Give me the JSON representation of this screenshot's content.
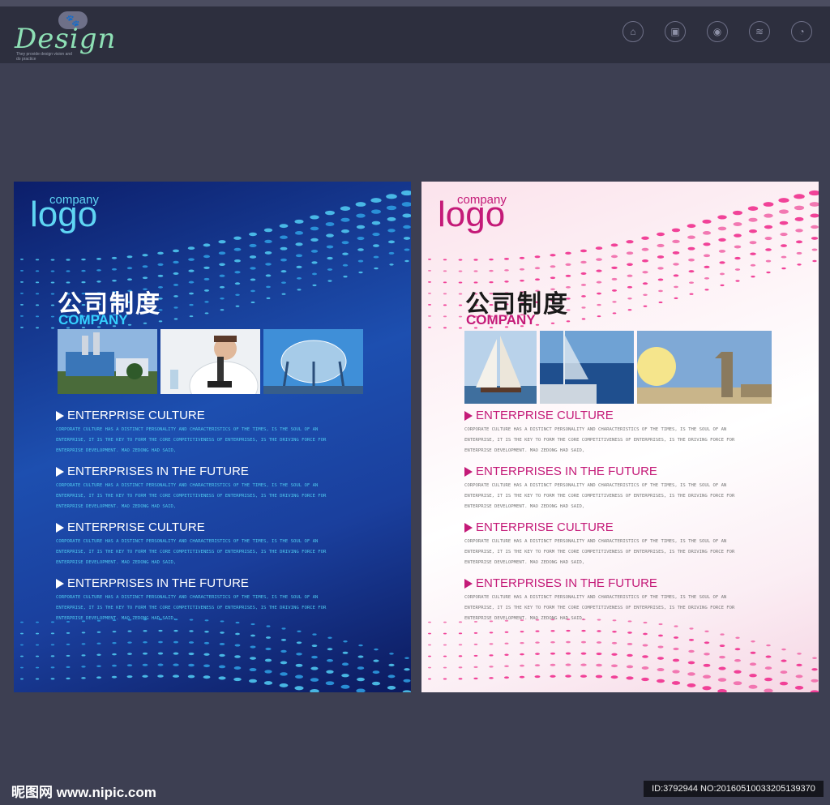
{
  "header": {
    "brand": "Design",
    "brand_tagline": "They provide design vision and do practice",
    "paw_glyph": "🐾",
    "icons": [
      {
        "icon": "hat-icon",
        "caption": "",
        "glyph": "⌂"
      },
      {
        "icon": "camera-icon",
        "caption": "",
        "glyph": "▣"
      },
      {
        "icon": "shield-icon",
        "caption": "",
        "glyph": "◉"
      },
      {
        "icon": "wifi-icon",
        "caption": "",
        "glyph": "≋"
      },
      {
        "icon": "chart-icon",
        "caption": "",
        "glyph": "◔"
      }
    ]
  },
  "posters": [
    {
      "theme": "blue",
      "logo_small": "company",
      "logo_big": "logo",
      "title_cn": "公司制度",
      "title_en": "COMPANY",
      "accent": "#35d0ff",
      "sections": [
        {
          "title": "ENTERPRISE CULTURE",
          "lines": [
            "CORPORATE CULTURE HAS A DISTINCT PERSONALITY AND CHARACTERISTICS OF THE TIMES, IS THE SOUL OF AN",
            "ENTERPRISE, IT IS THE KEY TO FORM THE CORE COMPETITIVENESS OF ENTERPRISES, IS THE DRIVING FORCE FOR",
            "ENTERPRISE DEVELOPMENT. MAO ZEDONG HAD SAID,"
          ]
        },
        {
          "title": "ENTERPRISES IN THE FUTURE",
          "lines": [
            "CORPORATE CULTURE HAS A DISTINCT PERSONALITY AND CHARACTERISTICS OF THE TIMES, IS THE SOUL OF AN",
            "ENTERPRISE, IT IS THE KEY TO FORM THE CORE COMPETITIVENESS OF ENTERPRISES, IS THE DRIVING FORCE FOR",
            "ENTERPRISE DEVELOPMENT. MAO ZEDONG HAD SAID,"
          ]
        },
        {
          "title": "ENTERPRISE CULTURE",
          "lines": [
            "CORPORATE CULTURE HAS A DISTINCT PERSONALITY AND CHARACTERISTICS OF THE TIMES, IS THE SOUL OF AN",
            "ENTERPRISE, IT IS THE KEY TO FORM THE CORE COMPETITIVENESS OF ENTERPRISES, IS THE DRIVING FORCE FOR",
            "ENTERPRISE DEVELOPMENT. MAO ZEDONG HAD SAID,"
          ]
        },
        {
          "title": "ENTERPRISES IN THE FUTURE",
          "lines": [
            "CORPORATE CULTURE HAS A DISTINCT PERSONALITY AND CHARACTERISTICS OF THE TIMES, IS THE SOUL OF AN",
            "ENTERPRISE, IT IS THE KEY TO FORM THE CORE COMPETITIVENESS OF ENTERPRISES, IS THE DRIVING FORCE FOR",
            "ENTERPRISE DEVELOPMENT. MAO ZEDONG HAD SAID,"
          ]
        }
      ]
    },
    {
      "theme": "pink",
      "logo_small": "company",
      "logo_big": "logo",
      "title_cn": "公司制度",
      "title_en": "COMPANY",
      "accent": "#c41a78",
      "sections": [
        {
          "title": "ENTERPRISE CULTURE",
          "lines": [
            "CORPORATE CULTURE HAS A DISTINCT PERSONALITY AND CHARACTERISTICS OF THE TIMES, IS THE SOUL OF AN",
            "ENTERPRISE, IT IS THE KEY TO FORM THE CORE COMPETITIVENESS OF ENTERPRISES, IS THE DRIVING FORCE FOR",
            "ENTERPRISE DEVELOPMENT. MAO ZEDONG HAD SAID,"
          ]
        },
        {
          "title": "ENTERPRISES IN THE FUTURE",
          "lines": [
            "CORPORATE CULTURE HAS A DISTINCT PERSONALITY AND CHARACTERISTICS OF THE TIMES, IS THE SOUL OF AN",
            "ENTERPRISE, IT IS THE KEY TO FORM THE CORE COMPETITIVENESS OF ENTERPRISES, IS THE DRIVING FORCE FOR",
            "ENTERPRISE DEVELOPMENT. MAO ZEDONG HAD SAID,"
          ]
        },
        {
          "title": "ENTERPRISE CULTURE",
          "lines": [
            "CORPORATE CULTURE HAS A DISTINCT PERSONALITY AND CHARACTERISTICS OF THE TIMES, IS THE SOUL OF AN",
            "ENTERPRISE, IT IS THE KEY TO FORM THE CORE COMPETITIVENESS OF ENTERPRISES, IS THE DRIVING FORCE FOR",
            "ENTERPRISE DEVELOPMENT. MAO ZEDONG HAD SAID,"
          ]
        },
        {
          "title": "ENTERPRISES IN THE FUTURE",
          "lines": [
            "CORPORATE CULTURE HAS A DISTINCT PERSONALITY AND CHARACTERISTICS OF THE TIMES, IS THE SOUL OF AN",
            "ENTERPRISE, IT IS THE KEY TO FORM THE CORE COMPETITIVENESS OF ENTERPRISES, IS THE DRIVING FORCE FOR",
            "ENTERPRISE DEVELOPMENT. MAO ZEDONG HAD SAID,"
          ]
        }
      ]
    }
  ],
  "watermark": {
    "site": "昵图网 www.nipic.com",
    "id_text": "ID:3792944 NO:20160510033205139370"
  }
}
